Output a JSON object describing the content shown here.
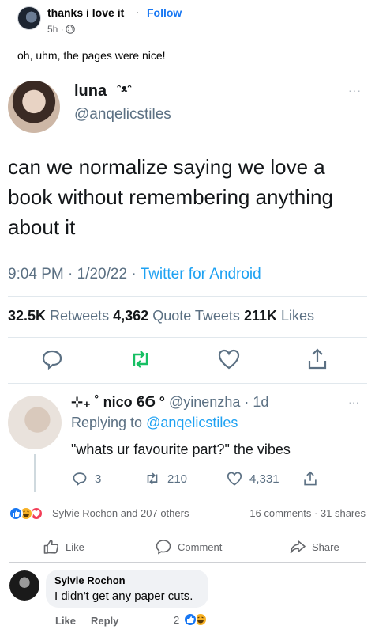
{
  "post_header": {
    "page_name": "thanks i love it",
    "separator": "·",
    "follow_label": "Follow",
    "time": "5h ·",
    "caption": "oh, uhm, the pages were nice!"
  },
  "tweet": {
    "display_name": "luna",
    "name_emoji": "ᵔᴥᵔ",
    "handle": "@anqelicstiles",
    "more": "···",
    "text": "can we normalize saying we love a book without remembering anything about it",
    "meta_time": "9:04 PM · 1/20/22 · ",
    "meta_app": "Twitter for Android",
    "stats": {
      "retweets_count": "32.5K",
      "retweets_label": "Retweets",
      "quotes_count": "4,362",
      "quotes_label": "Quote Tweets",
      "likes_count": "211K",
      "likes_label": "Likes"
    },
    "colors": {
      "accent": "#1da1f2",
      "retweet_green": "#17bf63",
      "muted": "#5b7083"
    }
  },
  "reply": {
    "name": "⊹₊ ˚ nico ϐϬ °",
    "handle_time": "@yinenzha · 1d",
    "more": "···",
    "replying_prefix": "Replying to",
    "replying_handle": "@anqelicstiles",
    "text": "\"whats ur favourite part?\" the vibes",
    "replies": "3",
    "retweets": "210",
    "likes": "4,331"
  },
  "reactions": {
    "names": "Sylvie Rochon and 207 others",
    "counts": "16 comments · 31 shares"
  },
  "actions": {
    "like": "Like",
    "comment": "Comment",
    "share": "Share"
  },
  "comment": {
    "author": "Sylvie Rochon",
    "text": "I didn't get any paper cuts.",
    "like_label": "Like",
    "reply_label": "Reply",
    "reaction_count": "2"
  },
  "colors": {
    "fb_blue": "#1877f2",
    "fb_muted": "#65676b"
  }
}
